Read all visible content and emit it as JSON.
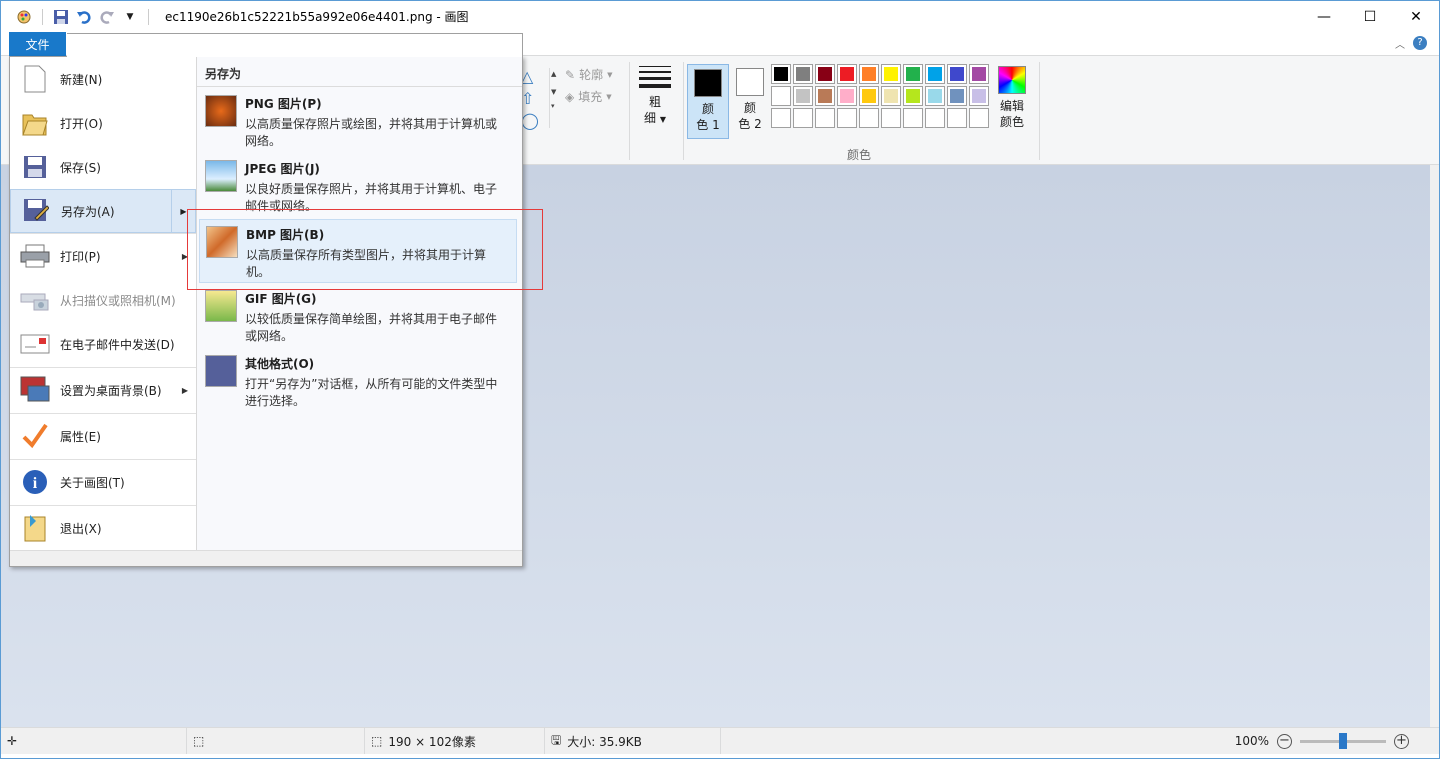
{
  "window": {
    "title": "ec1190e26b1c52221b55a992e06e4401.png - 画图",
    "controls": {
      "minimize": "—",
      "maximize": "☐",
      "close": "✕"
    }
  },
  "ribbon": {
    "file_tab": "文件",
    "shapes": {
      "outline_label": "轮廓",
      "fill_label": "填充"
    },
    "thickness": {
      "line1": "粗",
      "line2": "细"
    },
    "color1": {
      "line1": "颜",
      "line2": "色 1",
      "color": "#000000"
    },
    "color2": {
      "line1": "颜",
      "line2": "色 2",
      "color": "#ffffff"
    },
    "edit_colors": {
      "line1": "编辑",
      "line2": "颜色"
    },
    "colors_group_label": "颜色",
    "palette": [
      "#000000",
      "#7f7f7f",
      "#880015",
      "#ed1c24",
      "#ff7f27",
      "#fff200",
      "#22b14c",
      "#00a2e8",
      "#3f48cc",
      "#a349a4",
      "#ffffff",
      "#c3c3c3",
      "#b97a57",
      "#ffaec9",
      "#ffc90e",
      "#efe4b0",
      "#b5e61d",
      "#99d9ea",
      "#7092be",
      "#c8bfe7",
      "",
      "",
      "",
      "",
      "",
      "",
      "",
      "",
      "",
      ""
    ]
  },
  "file_menu": {
    "items": [
      {
        "label": "新建(N)"
      },
      {
        "label": "打开(O)"
      },
      {
        "label": "保存(S)"
      },
      {
        "label": "另存为(A)"
      },
      {
        "label": "打印(P)"
      },
      {
        "label": "从扫描仪或照相机(M)"
      },
      {
        "label": "在电子邮件中发送(D)"
      },
      {
        "label": "设置为桌面背景(B)"
      },
      {
        "label": "属性(E)"
      },
      {
        "label": "关于画图(T)"
      },
      {
        "label": "退出(X)"
      }
    ],
    "save_as": {
      "heading": "另存为",
      "options": [
        {
          "title": "PNG 图片(P)",
          "desc": "以高质量保存照片或绘图，并将其用于计算机或网络。"
        },
        {
          "title": "JPEG 图片(J)",
          "desc": "以良好质量保存照片，并将其用于计算机、电子邮件或网络。"
        },
        {
          "title": "BMP 图片(B)",
          "desc": "以高质量保存所有类型图片，并将其用于计算机。"
        },
        {
          "title": "GIF 图片(G)",
          "desc": "以较低质量保存简单绘图，并将其用于电子邮件或网络。"
        },
        {
          "title": "其他格式(O)",
          "desc": "打开“另存为”对话框，从所有可能的文件类型中进行选择。"
        }
      ]
    }
  },
  "statusbar": {
    "dimensions": "190 × 102像素",
    "size": "大小: 35.9KB",
    "zoom": "100%",
    "zoom_level": 0.5
  }
}
